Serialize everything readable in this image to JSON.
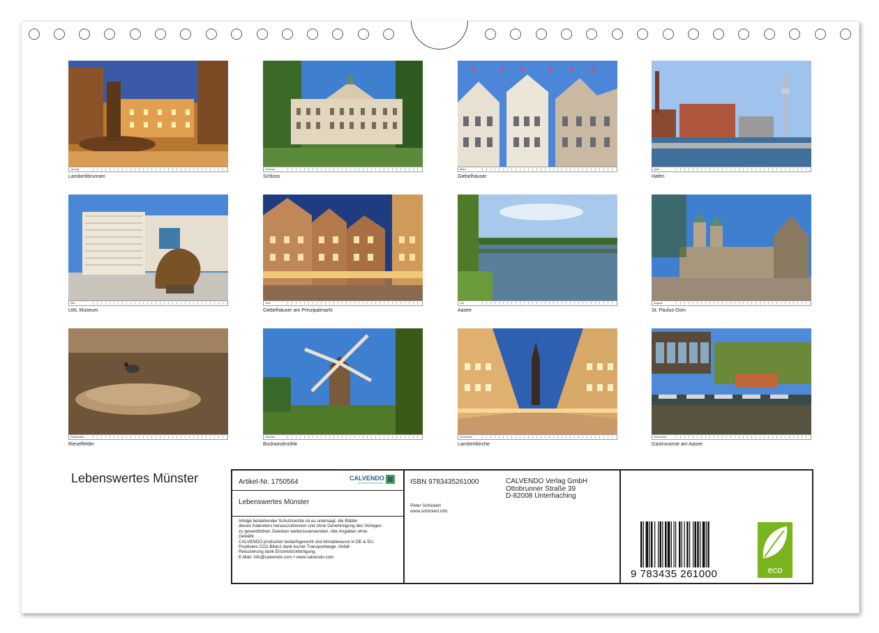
{
  "calendar": {
    "title": "Lebenswertes Münster",
    "months": [
      {
        "month": "Januar",
        "caption": "Lambertibrunnen",
        "scene": "fountain-square"
      },
      {
        "month": "Februar",
        "caption": "Schloss",
        "scene": "palace"
      },
      {
        "month": "März",
        "caption": "Giebelhäuser",
        "scene": "gables-flags"
      },
      {
        "month": "April",
        "caption": "Hafen",
        "scene": "harbor"
      },
      {
        "month": "Mai",
        "caption": "LWL Museum",
        "scene": "museum"
      },
      {
        "month": "Juni",
        "caption": "Giebelhäuser am Prinzipalmarkt",
        "scene": "gables-night"
      },
      {
        "month": "Juli",
        "caption": "Aasee",
        "scene": "lake"
      },
      {
        "month": "August",
        "caption": "St. Paulus-Dom",
        "scene": "cathedral"
      },
      {
        "month": "September",
        "caption": "Rieselfelder",
        "scene": "nest"
      },
      {
        "month": "Oktober",
        "caption": "Bockwindmühle",
        "scene": "windmill"
      },
      {
        "month": "November",
        "caption": "Lambertikirche",
        "scene": "church-street"
      },
      {
        "month": "Dezember",
        "caption": "Gastronomie am Aasee",
        "scene": "lakeside"
      }
    ]
  },
  "info": {
    "article": "Artikel-Nr. 1750564",
    "product_title": "Lebenswertes Münster",
    "legal_lines": [
      "Infolge bestehender Schutzrechte ist es untersagt, die Blätter",
      "dieses Kalenders herauszutrennen und ohne Genehmigung des Verlages",
      "zu gewerblichen Zwecken weiterzuverwenden. Alle Angaben ohne",
      "Gewähr.",
      "CALVENDO produziert bedarfsgerecht und klimabewusst in DE & EU.",
      "Positivere CO2-Bilanz dank kurzer Transportwege. Abfall-",
      "Reduzierung dank Einzelstückfertigung.",
      "E-Mail: info@calvendo.com • www.calvendo.com"
    ],
    "isbn": "ISBN 9783435261000",
    "publisher_lines": [
      "CALVENDO Verlag GmbH",
      "Ottobrunner Straße 39",
      "D-82008 Unterhaching"
    ],
    "author": "Peter Schickert",
    "author_site": "www.schickert.info",
    "barcode_number": "9 783435 261000",
    "logo_text": "CALVENDO",
    "eco_text": "eco"
  }
}
